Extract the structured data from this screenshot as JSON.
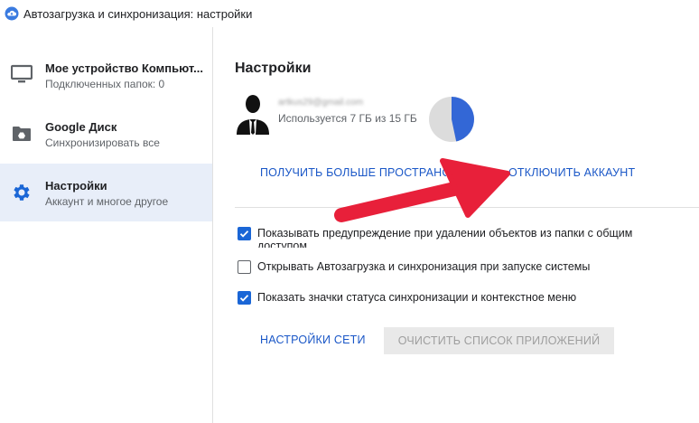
{
  "window": {
    "title": "Автозагрузка и синхронизация: настройки",
    "app_icon": "cloud-icon"
  },
  "sidebar": {
    "items": [
      {
        "title": "Мое устройство Компьют...",
        "subtitle": "Подключенных папок: 0",
        "icon": "monitor-icon",
        "active": false
      },
      {
        "title": "Google Диск",
        "subtitle": "Синхронизировать все",
        "icon": "drive-folder-icon",
        "active": false
      },
      {
        "title": "Настройки",
        "subtitle": "Аккаунт и многое другое",
        "icon": "gear-icon",
        "active": true
      }
    ]
  },
  "settings": {
    "title": "Настройки",
    "account": {
      "email": "artkus29@gmail.com",
      "usage_text": "Используется 7 ГБ из 15 ГБ",
      "used_fraction": 0.4667
    },
    "more_space_label": "ПОЛУЧИТЬ БОЛЬШЕ ПРОСТРАНСТВА",
    "disconnect_label": "ОТКЛЮЧИТЬ АККАУНТ",
    "options": [
      {
        "label": "Показывать предупреждение при удалении объектов из папки с общим доступом",
        "checked": true
      },
      {
        "label": "Открывать Автозагрузка и синхронизация при запуске системы",
        "checked": false
      },
      {
        "label": "Показать значки статуса синхронизации и контекстное меню",
        "checked": true
      }
    ],
    "network_settings_label": "НАСТРОЙКИ СЕТИ",
    "clear_apps_label": "ОЧИСТИТЬ СПИСОК ПРИЛОЖЕНИЙ"
  },
  "colors": {
    "accent": "#1a57c7",
    "checkbox": "#1a66d6",
    "active_nav": "#e8eef9",
    "pie_used": "#3367d6",
    "pie_free": "#dcdcdc",
    "annotation_arrow": "#e8203a"
  }
}
